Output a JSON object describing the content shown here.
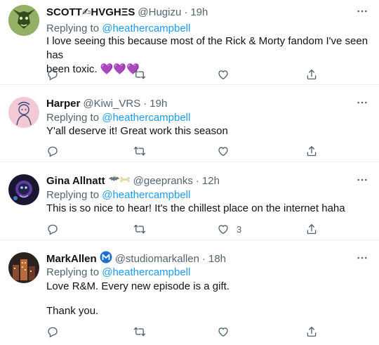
{
  "tweets": [
    {
      "display_name": "SCOTT✍HVGHΞS",
      "handle": "@Hugizu",
      "time": "19h",
      "replying_prefix": "Replying to ",
      "replying_to": "@heathercampbell",
      "text_lines": [
        "I love seeing this because most of the Rick & Morty fandom I've seen has",
        "been toxic. 💜💜💜"
      ],
      "like_count": "",
      "avatar": "green-creature-avatar"
    },
    {
      "display_name": "Harper",
      "handle": "@Kiwi_VRS",
      "time": "19h",
      "replying_prefix": "Replying to ",
      "replying_to": "@heathercampbell",
      "text_lines": [
        "Y'all deserve it! Great work this season"
      ],
      "like_count": "",
      "avatar": "pink-sketch-avatar"
    },
    {
      "display_name": "Gina Allnatt",
      "handle": "@geepranks",
      "time": "12h",
      "replying_prefix": "Replying to ",
      "replying_to": "@heathercampbell",
      "text_lines": [
        "This is so nice to hear! It's the chillest place on the internet haha"
      ],
      "like_count": "3",
      "avatar": "dark-purple-avatar"
    },
    {
      "display_name": "MarkAllen",
      "handle": "@studiomarkallen",
      "time": "18h",
      "replying_prefix": "Replying to ",
      "replying_to": "@heathercampbell",
      "text_lines": [
        "Love R&M. Every new episode is a gift.",
        "",
        "Thank you."
      ],
      "like_count": "",
      "avatar": "dark-city-avatar"
    }
  ],
  "icons": {
    "more": "more-icon",
    "reply": "reply-icon",
    "retweet": "retweet-icon",
    "like": "like-icon",
    "share": "share-icon"
  },
  "colors": {
    "link": "#1d9bf0",
    "secondary_text": "#536471",
    "primary_text": "#0f1419",
    "divider": "#eff3f4"
  }
}
